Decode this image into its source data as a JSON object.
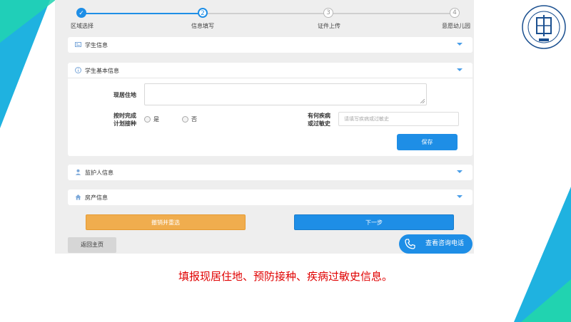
{
  "steps": [
    {
      "label": "区域选择",
      "number": "",
      "state": "done"
    },
    {
      "label": "信息填写",
      "number": "2",
      "state": "active"
    },
    {
      "label": "证件上传",
      "number": "3",
      "state": "todo"
    },
    {
      "label": "意愿幼儿园",
      "number": "4",
      "state": "todo"
    }
  ],
  "sections": {
    "student_info": "学生信息",
    "student_basic": "学生基本信息",
    "guardian": "监护人信息",
    "property": "房产信息"
  },
  "form": {
    "address_label": "现居住地",
    "address_value": "",
    "vaccination_label_1": "按时完成",
    "vaccination_label_2": "计划接种",
    "option_yes": "是",
    "option_no": "否",
    "disease_label_1": "有何疾病",
    "disease_label_2": "或过敏史",
    "disease_placeholder": "请填写疾病或过敏史",
    "save_label": "保存"
  },
  "actions": {
    "reset_label": "撤销并重选",
    "next_label": "下一步",
    "home_label": "返回主页",
    "phone_label": "查看咨询电话"
  },
  "logo": {
    "text": "CRRS EDUCATION",
    "sub": "教育局"
  },
  "caption": "填报现居住地、预防接种、疾病过敏史信息。",
  "colors": {
    "accent": "#1e8ee6",
    "warning": "#f0ad4e",
    "caption": "#e00000"
  }
}
